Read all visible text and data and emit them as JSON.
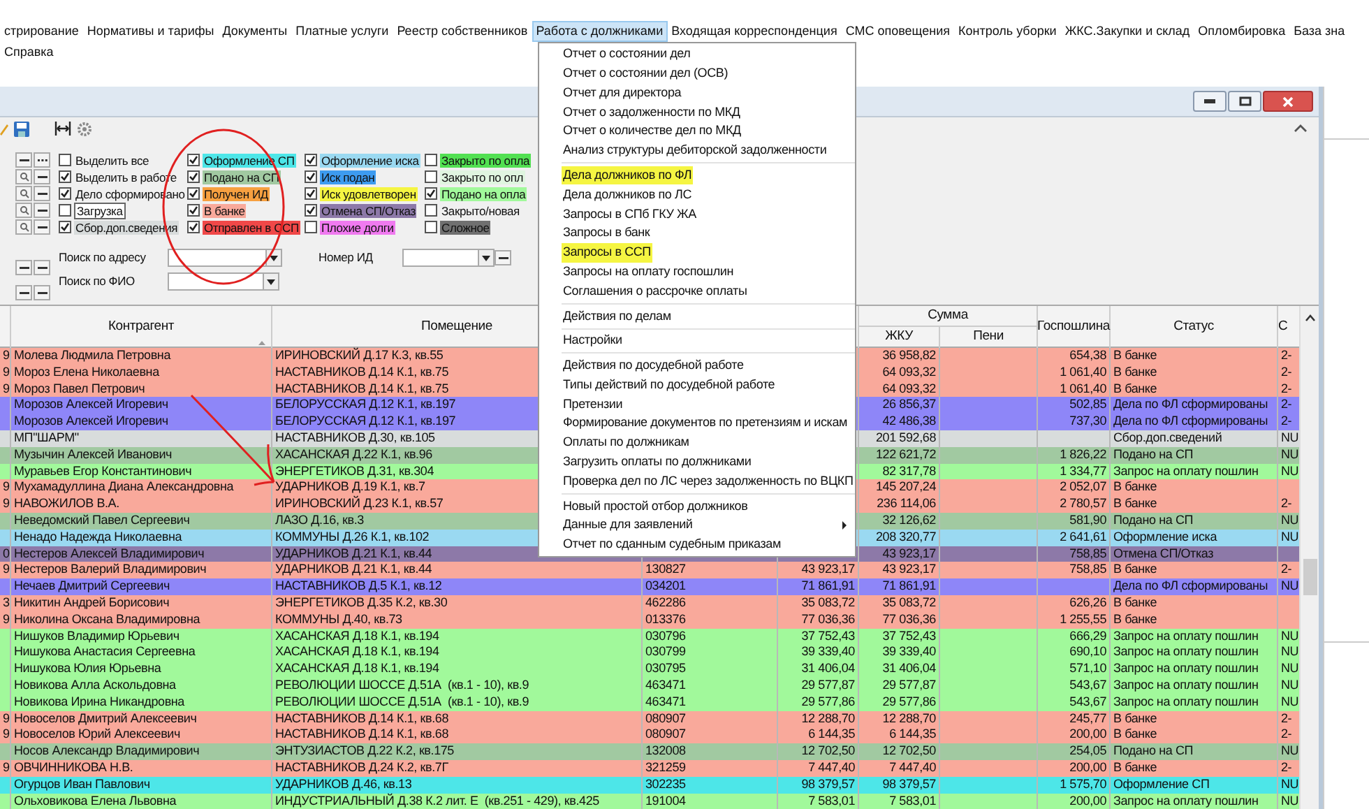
{
  "menu_bar": {
    "items": [
      {
        "label": "стрирование",
        "selected": false
      },
      {
        "label": "Нормативы и тарифы",
        "selected": false
      },
      {
        "label": "Документы",
        "selected": false
      },
      {
        "label": "Платные услуги",
        "selected": false
      },
      {
        "label": "Реестр собственников",
        "selected": false
      },
      {
        "label": "Работа с должниками",
        "selected": true
      },
      {
        "label": "Входящая корреспонденция",
        "selected": false
      },
      {
        "label": "СМС оповещения",
        "selected": false
      },
      {
        "label": "Контроль уборки",
        "selected": false
      },
      {
        "label": "ЖКС.Закупки и склад",
        "selected": false
      },
      {
        "label": "Опломбировка",
        "selected": false
      },
      {
        "label": "База зна",
        "selected": false
      }
    ],
    "row_2": [
      {
        "label": "Справка",
        "selected": false
      }
    ]
  },
  "filters": {
    "checkbox_columns": [
      [
        {
          "label": "Выделить все",
          "checked": false
        },
        {
          "label": "Выделить в работе",
          "checked": true
        },
        {
          "label": "Дело сформировано",
          "checked": true
        },
        {
          "label": "Загрузка",
          "checked": false,
          "color": "#ffffff"
        },
        {
          "label": "Сбор.доп.сведения",
          "checked": true,
          "color": "#d8dcdc"
        }
      ],
      [
        {
          "label": "Оформление СП",
          "checked": true,
          "color": "#4de6e8"
        },
        {
          "label": "Подано на СП",
          "checked": true,
          "color": "#a1c9a1"
        },
        {
          "label": "Получен ИД",
          "checked": true,
          "color": "#f7a040"
        },
        {
          "label": "В банке",
          "checked": true,
          "color": "#f9a99b"
        },
        {
          "label": "Отправлен в ССП",
          "checked": true,
          "color": "#f04848"
        }
      ],
      [
        {
          "label": "Оформление иска",
          "checked": true,
          "color": "#9ad9f1"
        },
        {
          "label": "Иск подан",
          "checked": true,
          "color": "#3d9bf0"
        },
        {
          "label": "Иск удовлетворен",
          "checked": true,
          "color": "#f5f542"
        },
        {
          "label": "Отмена СП/Отказ",
          "checked": true,
          "color": "#8d79a8"
        },
        {
          "label": "Плохие долги",
          "checked": false,
          "color": "#f07af0"
        }
      ],
      [
        {
          "label": "Закрыто по опла",
          "checked": false,
          "color": "#52e052"
        },
        {
          "label": "Закрыто по опл",
          "checked": false,
          "color": "#e0f5e0"
        },
        {
          "label": "Подано на опла",
          "checked": true,
          "color": "#a1f99b"
        },
        {
          "label": "Закрыто/новая",
          "checked": false,
          "color": "#f0f0f0"
        },
        {
          "label": "Сложное",
          "checked": false,
          "color": "#707070"
        }
      ]
    ],
    "address_search": {
      "label": "Поиск по адресу"
    },
    "id_number": {
      "label": "Номер ИД"
    },
    "name_search": {
      "label": "Поиск по ФИО"
    }
  },
  "table": {
    "header": {
      "contragent": "Контрагент",
      "premises": "Помещение",
      "sum_group": "Сумма",
      "zhku": "ЖКУ",
      "penalty": "Пени",
      "duty": "Госпошлина",
      "status": "Статус",
      "column_last": "С"
    },
    "rows": [
      {
        "edge": "9",
        "contragent": "Молева Людмила Петровна",
        "premises": "ИРИНОВСКИЙ Д.17 К.3, кв.55",
        "zhku": "36 958,82",
        "duty": "654,38",
        "status": "В банке",
        "column_last": "2-",
        "color": "#f9a99b"
      },
      {
        "edge": "9",
        "contragent": "Мороз Елена Николаевна",
        "premises": "НАСТАВНИКОВ Д.14 К.1, кв.75",
        "zhku": "64 093,32",
        "duty": "1 061,40",
        "status": "В банке",
        "column_last": "2-",
        "color": "#f9a99b"
      },
      {
        "edge": "9",
        "contragent": "Мороз Павел Петрович",
        "premises": "НАСТАВНИКОВ Д.14 К.1, кв.75",
        "zhku": "64 093,32",
        "duty": "1 061,40",
        "status": "В банке",
        "column_last": "2-",
        "color": "#f9a99b"
      },
      {
        "contragent": "Морозов Алексей Игоревич",
        "premises": "БЕЛОРУССКАЯ Д.12 К.1, кв.197",
        "zhku": "26 856,37",
        "duty": "502,85",
        "status": "Дела по ФЛ сформированы",
        "column_last": "2-",
        "color": "#8e86f8"
      },
      {
        "contragent": "Морозов Алексей Игоревич",
        "premises": "БЕЛОРУССКАЯ Д.12 К.1, кв.197",
        "zhku": "42 486,38",
        "duty": "737,30",
        "status": "Дела по ФЛ сформированы",
        "column_last": "2-",
        "color": "#8e86f8"
      },
      {
        "contragent": "МП\"ШАРМ\"",
        "premises": "НАСТАВНИКОВ Д.30, кв.105",
        "zhku": "201 592,68",
        "status": "Сбор.доп.сведений",
        "column_last": "NU",
        "color": "#d8dcdc"
      },
      {
        "contragent": "Музычин Алексей Иванович",
        "premises": "ХАСАНСКАЯ Д.22 К.1, кв.96",
        "zhku": "122 621,72",
        "duty": "1 826,22",
        "status": "Подано на СП",
        "column_last": "NU",
        "color": "#a1c9a1"
      },
      {
        "contragent": "Муравьев Егор Константинович",
        "premises": "ЭНЕРГЕТИКОВ Д.31, кв.304",
        "zhku": "82 317,78",
        "duty": "1 334,77",
        "status": "Запрос на оплату пошлин",
        "column_last": "NU",
        "color": "#a1f99b"
      },
      {
        "edge": "9",
        "contragent": "Мухамадуллина Диана Александровна",
        "premises": "УДАРНИКОВ Д.19 К.1, кв.7",
        "zhku": "145 207,24",
        "duty": "2 052,07",
        "status": "В банке",
        "color": "#f9a99b"
      },
      {
        "edge": "9",
        "contragent": "НАВОЖИЛОВ В.А.",
        "premises": "ИРИНОВСКИЙ Д.23 К.1, кв.57",
        "zhku": "236 114,06",
        "duty": "2 780,57",
        "status": "В банке",
        "column_last": "2-",
        "color": "#f9a99b"
      },
      {
        "contragent": "Неведомский Павел Сергеевич",
        "premises": "ЛАЗО Д.16, кв.3",
        "zhku": "32 126,62",
        "duty": "581,90",
        "status": "Подано на СП",
        "column_last": "NU",
        "color": "#a1c9a1"
      },
      {
        "contragent": "Ненадо Надежда Николаевна",
        "premises": "КОММУНЫ Д.26 К.1, кв.102",
        "zhku": "208 320,77",
        "duty": "2 641,61",
        "status": "Оформление иска",
        "column_last": "NU",
        "color": "#9ad9f1"
      },
      {
        "edge": "0",
        "contragent": "Нестеров Алексей Владимирович",
        "premises": "УДАРНИКОВ Д.21 К.1, кв.44",
        "zhku": "43 923,17",
        "duty": "758,85",
        "status": "Отмена СП/Отказ",
        "color": "#8d79a8"
      },
      {
        "edge": "9",
        "contragent": "Нестеров Валерий Владимирович",
        "premises": "УДАРНИКОВ Д.21 К.1, кв.44",
        "account": "130827",
        "total": "43 923,17",
        "zhku": "43 923,17",
        "duty": "758,85",
        "status": "В банке",
        "column_last": "2-",
        "color": "#f9a99b"
      },
      {
        "contragent": "Нечаев Дмитрий Сергеевич",
        "premises": "НАСТАВНИКОВ Д.5 К.1, кв.12",
        "account": "034201",
        "total": "71 861,91",
        "zhku": "71 861,91",
        "status": "Дела по ФЛ сформированы",
        "column_last": "NU",
        "color": "#8e86f8"
      },
      {
        "edge": "3",
        "contragent": "Никитин Андрей Борисович",
        "premises": "ЭНЕРГЕТИКОВ Д.35 К.2, кв.30",
        "account": "462286",
        "total": "35 083,72",
        "zhku": "35 083,72",
        "duty": "626,26",
        "status": "В банке",
        "color": "#f9a99b"
      },
      {
        "edge": "9",
        "contragent": "Николина Оксана Владимировна",
        "premises": "КОММУНЫ Д.40, кв.73",
        "account": "013376",
        "total": "77 036,36",
        "zhku": "77 036,36",
        "duty": "1 255,55",
        "status": "В банке",
        "color": "#f9a99b"
      },
      {
        "contragent": "Нишуков Владимир Юрьевич",
        "premises": "ХАСАНСКАЯ Д.18 К.1, кв.194",
        "account": "030796",
        "total": "37 752,43",
        "zhku": "37 752,43",
        "duty": "666,29",
        "status": "Запрос на оплату пошлин",
        "column_last": "NU",
        "color": "#a1f99b"
      },
      {
        "contragent": "Нишукова Анастасия Сергеевна",
        "premises": "ХАСАНСКАЯ Д.18 К.1, кв.194",
        "account": "030799",
        "total": "39 339,40",
        "zhku": "39 339,40",
        "duty": "690,10",
        "status": "Запрос на оплату пошлин",
        "column_last": "NU",
        "color": "#a1f99b"
      },
      {
        "contragent": "Нишукова Юлия Юрьевна",
        "premises": "ХАСАНСКАЯ Д.18 К.1, кв.194",
        "account": "030795",
        "total": "31 406,04",
        "zhku": "31 406,04",
        "duty": "571,10",
        "status": "Запрос на оплату пошлин",
        "column_last": "NU",
        "color": "#a1f99b"
      },
      {
        "contragent": "Новикова Алла Аскольдовна",
        "premises": "РЕВОЛЮЦИИ ШОССЕ Д.51А  (кв.1 - 10), кв.9",
        "account": "463471",
        "total": "29 577,87",
        "zhku": "29 577,87",
        "duty": "543,67",
        "status": "Запрос на оплату пошлин",
        "column_last": "NU",
        "color": "#a1f99b"
      },
      {
        "contragent": "Новикова Ирина Никандровна",
        "premises": "РЕВОЛЮЦИИ ШОССЕ Д.51А  (кв.1 - 10), кв.9",
        "account": "463471",
        "total": "29 577,86",
        "zhku": "29 577,86",
        "duty": "543,67",
        "status": "Запрос на оплату пошлин",
        "column_last": "NU",
        "color": "#a1f99b"
      },
      {
        "edge": "9",
        "contragent": "Новоселов Дмитрий Алексеевич",
        "premises": "НАСТАВНИКОВ Д.14 К.1, кв.68",
        "account": "080907",
        "total": "12 288,70",
        "zhku": "12 288,70",
        "duty": "245,77",
        "status": "В банке",
        "column_last": "2-",
        "color": "#f9a99b"
      },
      {
        "edge": "9",
        "contragent": "Новоселов Юрий Алексеевич",
        "premises": "НАСТАВНИКОВ Д.14 К.1, кв.68",
        "account": "080907",
        "total": "6 144,35",
        "zhku": "6 144,35",
        "duty": "200,00",
        "status": "В банке",
        "column_last": "2-",
        "color": "#f9a99b"
      },
      {
        "contragent": "Носов Александр Владимирович",
        "premises": "ЭНТУЗИАСТОВ Д.22 К.2, кв.175",
        "account": "132008",
        "total": "12 702,50",
        "zhku": "12 702,50",
        "duty": "254,05",
        "status": "Подано на СП",
        "column_last": "NU",
        "color": "#a1c9a1"
      },
      {
        "edge": "9",
        "contragent": "ОВЧИННИКОВА Н.В.",
        "premises": "НАСТАВНИКОВ Д.24 К.2, кв.7Г",
        "account": "321259",
        "total": "7 447,40",
        "zhku": "7 447,40",
        "duty": "200,00",
        "status": "В банке",
        "column_last": "2-",
        "color": "#f9a99b"
      },
      {
        "contragent": "Огурцов Иван Павлович",
        "premises": "УДАРНИКОВ Д.46, кв.13",
        "account": "302235",
        "total": "98 379,57",
        "zhku": "98 379,57",
        "duty": "1 575,70",
        "status": "Оформление СП",
        "column_last": "NU",
        "color": "#4de6e8"
      },
      {
        "contragent": "Ольховикова Елена Львовна",
        "premises": "ИНДУСТРИАЛЬНЫЙ Д.38 К.2 лит. Е  (кв.251 - 429), кв.425",
        "account": "191004",
        "total": "7 583,01",
        "zhku": "7 583,01",
        "duty": "200,00",
        "status": "Запрос на оплату пошлин",
        "column_last": "NU",
        "color": "#a1f99b"
      }
    ]
  },
  "dropdown_menu": {
    "items": [
      {
        "kind": "item",
        "label": "Отчет о состоянии дел",
        "marked": false
      },
      {
        "kind": "item",
        "label": "Отчет о состоянии дел (ОСВ)",
        "marked": false
      },
      {
        "kind": "item",
        "label": "Отчет для директора",
        "marked": false
      },
      {
        "kind": "item",
        "label": "Отчет о задолженности по МКД",
        "marked": false
      },
      {
        "kind": "item",
        "label": "Отчет о количестве дел по МКД",
        "marked": false
      },
      {
        "kind": "item",
        "label": "Анализ структуры дебиторской задолженности",
        "marked": false
      },
      {
        "kind": "separator"
      },
      {
        "kind": "item",
        "label": "Дела должников по ФЛ",
        "marked": true
      },
      {
        "kind": "item",
        "label": "Дела должников по ЛС",
        "marked": false
      },
      {
        "kind": "item",
        "label": "Запросы в СПб ГКУ ЖА",
        "marked": false
      },
      {
        "kind": "item",
        "label": "Запросы в банк",
        "marked": false
      },
      {
        "kind": "item",
        "label": "Запросы в ССП",
        "marked": true
      },
      {
        "kind": "item",
        "label": "Запросы на оплату госпошлин",
        "marked": false
      },
      {
        "kind": "item",
        "label": "Соглашения о рассрочке оплаты",
        "marked": false
      },
      {
        "kind": "separator"
      },
      {
        "kind": "item",
        "label": "Действия по делам",
        "marked": false
      },
      {
        "kind": "separator"
      },
      {
        "kind": "item",
        "label": "Настройки",
        "marked": false
      },
      {
        "kind": "separator"
      },
      {
        "kind": "item",
        "label": "Действия по досудебной работе",
        "marked": false
      },
      {
        "kind": "item",
        "label": "Типы действий по досудебной работе",
        "marked": false
      },
      {
        "kind": "item",
        "label": "Претензии",
        "marked": false
      },
      {
        "kind": "item",
        "label": "Формирование документов по претензиям и искам",
        "marked": false
      },
      {
        "kind": "item",
        "label": "Оплаты по должникам",
        "marked": false
      },
      {
        "kind": "item",
        "label": "Загрузить оплаты по должниками",
        "marked": false
      },
      {
        "kind": "item",
        "label": "Проверка дел по ЛС через задолженность по ВЦКП",
        "marked": false
      },
      {
        "kind": "separator"
      },
      {
        "kind": "item",
        "label": "Новый простой отбор должников",
        "marked": false
      },
      {
        "kind": "submenu",
        "label": "Данные для заявлений",
        "marked": false
      },
      {
        "kind": "item",
        "label": "Отчет по сданным судебным приказам",
        "marked": false
      }
    ]
  }
}
